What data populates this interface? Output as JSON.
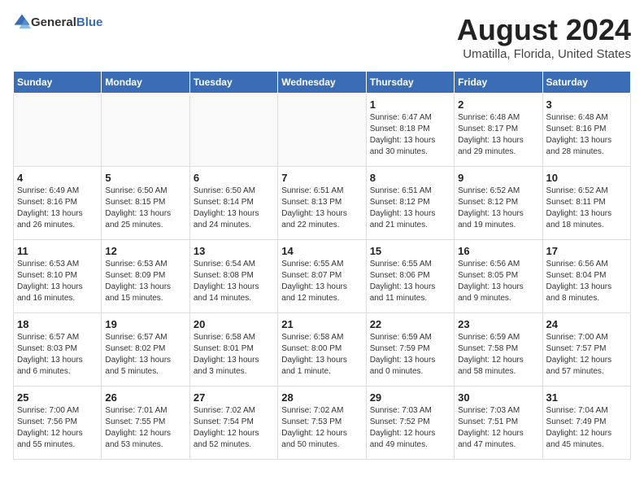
{
  "header": {
    "logo_general": "General",
    "logo_blue": "Blue",
    "title": "August 2024",
    "subtitle": "Umatilla, Florida, United States"
  },
  "calendar": {
    "weekdays": [
      "Sunday",
      "Monday",
      "Tuesday",
      "Wednesday",
      "Thursday",
      "Friday",
      "Saturday"
    ],
    "weeks": [
      [
        {
          "day": "",
          "info": ""
        },
        {
          "day": "",
          "info": ""
        },
        {
          "day": "",
          "info": ""
        },
        {
          "day": "",
          "info": ""
        },
        {
          "day": "1",
          "info": "Sunrise: 6:47 AM\nSunset: 8:18 PM\nDaylight: 13 hours\nand 30 minutes."
        },
        {
          "day": "2",
          "info": "Sunrise: 6:48 AM\nSunset: 8:17 PM\nDaylight: 13 hours\nand 29 minutes."
        },
        {
          "day": "3",
          "info": "Sunrise: 6:48 AM\nSunset: 8:16 PM\nDaylight: 13 hours\nand 28 minutes."
        }
      ],
      [
        {
          "day": "4",
          "info": "Sunrise: 6:49 AM\nSunset: 8:16 PM\nDaylight: 13 hours\nand 26 minutes."
        },
        {
          "day": "5",
          "info": "Sunrise: 6:50 AM\nSunset: 8:15 PM\nDaylight: 13 hours\nand 25 minutes."
        },
        {
          "day": "6",
          "info": "Sunrise: 6:50 AM\nSunset: 8:14 PM\nDaylight: 13 hours\nand 24 minutes."
        },
        {
          "day": "7",
          "info": "Sunrise: 6:51 AM\nSunset: 8:13 PM\nDaylight: 13 hours\nand 22 minutes."
        },
        {
          "day": "8",
          "info": "Sunrise: 6:51 AM\nSunset: 8:12 PM\nDaylight: 13 hours\nand 21 minutes."
        },
        {
          "day": "9",
          "info": "Sunrise: 6:52 AM\nSunset: 8:12 PM\nDaylight: 13 hours\nand 19 minutes."
        },
        {
          "day": "10",
          "info": "Sunrise: 6:52 AM\nSunset: 8:11 PM\nDaylight: 13 hours\nand 18 minutes."
        }
      ],
      [
        {
          "day": "11",
          "info": "Sunrise: 6:53 AM\nSunset: 8:10 PM\nDaylight: 13 hours\nand 16 minutes."
        },
        {
          "day": "12",
          "info": "Sunrise: 6:53 AM\nSunset: 8:09 PM\nDaylight: 13 hours\nand 15 minutes."
        },
        {
          "day": "13",
          "info": "Sunrise: 6:54 AM\nSunset: 8:08 PM\nDaylight: 13 hours\nand 14 minutes."
        },
        {
          "day": "14",
          "info": "Sunrise: 6:55 AM\nSunset: 8:07 PM\nDaylight: 13 hours\nand 12 minutes."
        },
        {
          "day": "15",
          "info": "Sunrise: 6:55 AM\nSunset: 8:06 PM\nDaylight: 13 hours\nand 11 minutes."
        },
        {
          "day": "16",
          "info": "Sunrise: 6:56 AM\nSunset: 8:05 PM\nDaylight: 13 hours\nand 9 minutes."
        },
        {
          "day": "17",
          "info": "Sunrise: 6:56 AM\nSunset: 8:04 PM\nDaylight: 13 hours\nand 8 minutes."
        }
      ],
      [
        {
          "day": "18",
          "info": "Sunrise: 6:57 AM\nSunset: 8:03 PM\nDaylight: 13 hours\nand 6 minutes."
        },
        {
          "day": "19",
          "info": "Sunrise: 6:57 AM\nSunset: 8:02 PM\nDaylight: 13 hours\nand 5 minutes."
        },
        {
          "day": "20",
          "info": "Sunrise: 6:58 AM\nSunset: 8:01 PM\nDaylight: 13 hours\nand 3 minutes."
        },
        {
          "day": "21",
          "info": "Sunrise: 6:58 AM\nSunset: 8:00 PM\nDaylight: 13 hours\nand 1 minute."
        },
        {
          "day": "22",
          "info": "Sunrise: 6:59 AM\nSunset: 7:59 PM\nDaylight: 13 hours\nand 0 minutes."
        },
        {
          "day": "23",
          "info": "Sunrise: 6:59 AM\nSunset: 7:58 PM\nDaylight: 12 hours\nand 58 minutes."
        },
        {
          "day": "24",
          "info": "Sunrise: 7:00 AM\nSunset: 7:57 PM\nDaylight: 12 hours\nand 57 minutes."
        }
      ],
      [
        {
          "day": "25",
          "info": "Sunrise: 7:00 AM\nSunset: 7:56 PM\nDaylight: 12 hours\nand 55 minutes."
        },
        {
          "day": "26",
          "info": "Sunrise: 7:01 AM\nSunset: 7:55 PM\nDaylight: 12 hours\nand 53 minutes."
        },
        {
          "day": "27",
          "info": "Sunrise: 7:02 AM\nSunset: 7:54 PM\nDaylight: 12 hours\nand 52 minutes."
        },
        {
          "day": "28",
          "info": "Sunrise: 7:02 AM\nSunset: 7:53 PM\nDaylight: 12 hours\nand 50 minutes."
        },
        {
          "day": "29",
          "info": "Sunrise: 7:03 AM\nSunset: 7:52 PM\nDaylight: 12 hours\nand 49 minutes."
        },
        {
          "day": "30",
          "info": "Sunrise: 7:03 AM\nSunset: 7:51 PM\nDaylight: 12 hours\nand 47 minutes."
        },
        {
          "day": "31",
          "info": "Sunrise: 7:04 AM\nSunset: 7:49 PM\nDaylight: 12 hours\nand 45 minutes."
        }
      ]
    ]
  }
}
